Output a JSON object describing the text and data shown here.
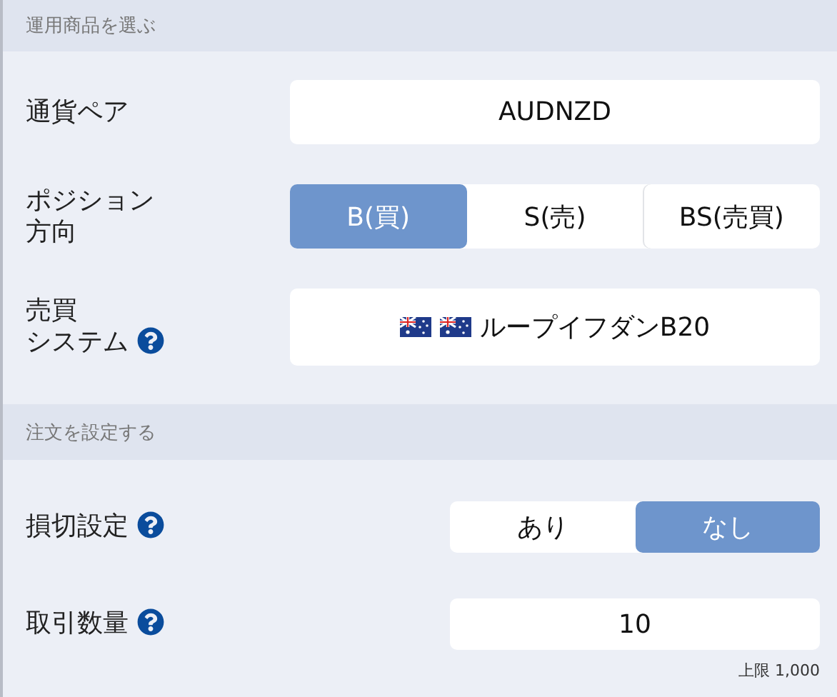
{
  "sections": [
    {
      "title": "運用商品を選ぶ",
      "rows": [
        {
          "kind": "field",
          "label": "通貨ペア",
          "help": false,
          "value": "AUDNZD"
        },
        {
          "kind": "segmented",
          "label_lines": [
            "ポジション",
            "方向"
          ],
          "help": false,
          "options": [
            {
              "label": "B(買)",
              "selected": true
            },
            {
              "label": "S(売)",
              "selected": false
            },
            {
              "label": "BS(売買)",
              "selected": false
            }
          ]
        },
        {
          "kind": "system",
          "label_lines": [
            "売買",
            "システム"
          ],
          "help": true,
          "value": "ループイフダンB20"
        }
      ]
    },
    {
      "title": "注文を設定する",
      "rows": [
        {
          "kind": "toggle",
          "label": "損切設定",
          "help": true,
          "options": [
            {
              "label": "あり",
              "selected": false
            },
            {
              "label": "なし",
              "selected": true
            }
          ]
        },
        {
          "kind": "quantity",
          "label": "取引数量",
          "help": true,
          "value": "10",
          "note": "上限 1,000"
        }
      ]
    }
  ]
}
